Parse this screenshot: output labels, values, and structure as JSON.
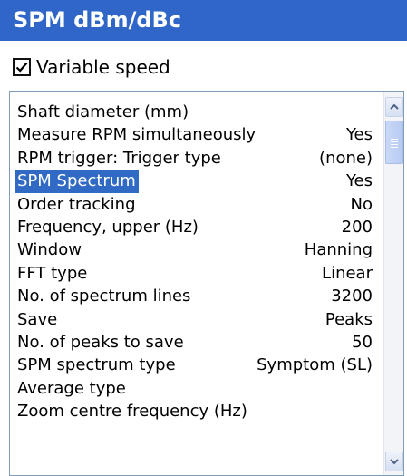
{
  "window": {
    "title": "SPM dBm/dBc"
  },
  "variable_speed": {
    "label": "Variable speed",
    "checked": true
  },
  "list": {
    "rows": [
      {
        "label": "Shaft diameter (mm)",
        "value": ""
      },
      {
        "label": "Measure RPM simultaneously",
        "value": "Yes"
      },
      {
        "label": "RPM trigger: Trigger type",
        "value": "(none)"
      },
      {
        "label": "SPM Spectrum",
        "value": "Yes",
        "selected": true
      },
      {
        "label": "Order tracking",
        "value": "No"
      },
      {
        "label": "Frequency, upper (Hz)",
        "value": "200"
      },
      {
        "label": "Window",
        "value": "Hanning"
      },
      {
        "label": "FFT type",
        "value": "Linear"
      },
      {
        "label": "No. of spectrum lines",
        "value": "3200"
      },
      {
        "label": "Save",
        "value": "Peaks"
      },
      {
        "label": "No. of peaks to save",
        "value": "50"
      },
      {
        "label": "SPM spectrum type",
        "value": "Symptom (SL)"
      },
      {
        "label": "Average type",
        "value": ""
      },
      {
        "label": "Zoom centre frequency (Hz)",
        "value": ""
      }
    ]
  },
  "colors": {
    "title_bar": "#2f66c8",
    "selection": "#316ac5",
    "list_border": "#7f9db9"
  },
  "icons": {
    "scroll_up": "chevron-up-icon",
    "scroll_down": "chevron-down-icon",
    "checkmark": "checkmark-icon"
  }
}
